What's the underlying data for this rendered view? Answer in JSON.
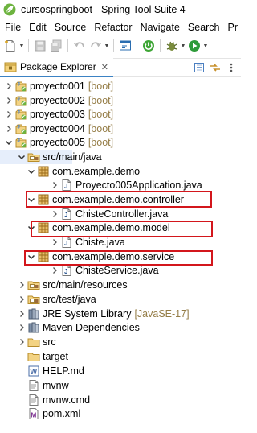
{
  "window": {
    "title": "cursospringboot - Spring Tool Suite 4",
    "icon": "spring-leaf-icon"
  },
  "menu": [
    "File",
    "Edit",
    "Source",
    "Refactor",
    "Navigate",
    "Search",
    "Pr"
  ],
  "toolbar": {
    "buttons": [
      "new-icon",
      "save-icon",
      "save-all-icon",
      "undo-icon",
      "redo-icon",
      "console-icon",
      "spring-boot-icon",
      "debug-icon",
      "run-icon"
    ]
  },
  "view": {
    "tab_label": "Package Explorer",
    "tab_close": "✕",
    "icon": "package-explorer-icon",
    "actions": [
      "collapse-all-icon",
      "link-editor-icon",
      "view-menu-icon"
    ]
  },
  "tree": [
    {
      "label": "proyecto001",
      "decoration": "[boot]",
      "icon": "boot-project-icon",
      "expanded": false,
      "level": 0
    },
    {
      "label": "proyecto002",
      "decoration": "[boot]",
      "icon": "boot-project-icon",
      "expanded": false,
      "level": 0
    },
    {
      "label": "proyecto003",
      "decoration": "[boot]",
      "icon": "boot-project-icon",
      "expanded": false,
      "level": 0
    },
    {
      "label": "proyecto004",
      "decoration": "[boot]",
      "icon": "boot-project-icon",
      "expanded": false,
      "level": 0
    },
    {
      "label": "proyecto005",
      "decoration": "[boot]",
      "icon": "boot-project-icon",
      "expanded": true,
      "level": 0
    },
    {
      "label": "src/main/java",
      "decoration": "",
      "icon": "source-folder-icon",
      "expanded": true,
      "level": 1,
      "selected": true
    },
    {
      "label": "com.example.demo",
      "decoration": "",
      "icon": "package-icon",
      "expanded": true,
      "level": 2
    },
    {
      "label": "Proyecto005Application.java",
      "decoration": "",
      "icon": "java-file-icon",
      "expanded": false,
      "level": 3
    },
    {
      "label": "com.example.demo.controller",
      "decoration": "",
      "icon": "package-icon",
      "expanded": true,
      "level": 2,
      "highlighted": true
    },
    {
      "label": "ChisteController.java",
      "decoration": "",
      "icon": "java-file-icon",
      "expanded": false,
      "level": 3
    },
    {
      "label": "com.example.demo.model",
      "decoration": "",
      "icon": "package-icon",
      "expanded": true,
      "level": 2,
      "highlighted": true
    },
    {
      "label": "Chiste.java",
      "decoration": "",
      "icon": "java-file-icon",
      "expanded": false,
      "level": 3
    },
    {
      "label": "com.example.demo.service",
      "decoration": "",
      "icon": "package-icon",
      "expanded": true,
      "level": 2,
      "highlighted": true
    },
    {
      "label": "ChisteService.java",
      "decoration": "",
      "icon": "java-file-icon",
      "expanded": false,
      "level": 3
    },
    {
      "label": "src/main/resources",
      "decoration": "",
      "icon": "source-folder-icon",
      "expanded": false,
      "level": 1
    },
    {
      "label": "src/test/java",
      "decoration": "",
      "icon": "source-folder-icon",
      "expanded": false,
      "level": 1
    },
    {
      "label": "JRE System Library",
      "decoration": "[JavaSE-17]",
      "icon": "library-icon",
      "expanded": false,
      "level": 1
    },
    {
      "label": "Maven Dependencies",
      "decoration": "",
      "icon": "library-icon",
      "expanded": false,
      "level": 1
    },
    {
      "label": "src",
      "decoration": "",
      "icon": "folder-icon",
      "expanded": false,
      "level": 1
    },
    {
      "label": "target",
      "decoration": "",
      "icon": "folder-icon",
      "expanded": null,
      "level": 1
    },
    {
      "label": "HELP.md",
      "decoration": "",
      "icon": "markdown-file-icon",
      "expanded": null,
      "level": 1
    },
    {
      "label": "mvnw",
      "decoration": "",
      "icon": "text-file-icon",
      "expanded": null,
      "level": 1
    },
    {
      "label": "mvnw.cmd",
      "decoration": "",
      "icon": "text-file-icon",
      "expanded": null,
      "level": 1
    },
    {
      "label": "pom.xml",
      "decoration": "",
      "icon": "maven-pom-icon",
      "expanded": null,
      "level": 1
    }
  ],
  "colors": {
    "highlight_border": "#d3161c",
    "decoration": "#957d47",
    "selection": "#e6eefb"
  }
}
